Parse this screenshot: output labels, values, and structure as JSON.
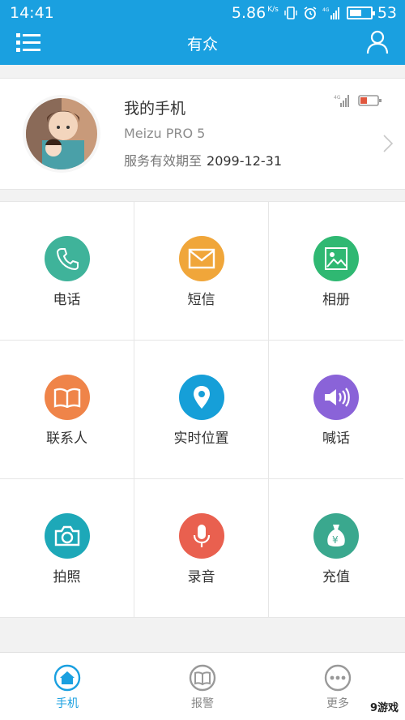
{
  "status_bar": {
    "time": "14:41",
    "net_speed": "5.86",
    "net_unit": "K/s",
    "signal": "4G",
    "battery": "53"
  },
  "header": {
    "title": "有众",
    "menu_icon": "menu-list-icon",
    "user_icon": "user-icon"
  },
  "profile": {
    "name": "我的手机",
    "model": "Meizu PRO 5",
    "expiry_label": "服务有效期至",
    "expiry_date": "2099-12-31",
    "signal_label": "4G"
  },
  "grid": [
    {
      "label": "电话",
      "icon": "phone-icon",
      "color": "#3fb39a"
    },
    {
      "label": "短信",
      "icon": "mail-icon",
      "color": "#f0a63a"
    },
    {
      "label": "相册",
      "icon": "image-icon",
      "color": "#2fb872"
    },
    {
      "label": "联系人",
      "icon": "book-icon",
      "color": "#ef8449"
    },
    {
      "label": "实时位置",
      "icon": "location-pin-icon",
      "color": "#169fd8"
    },
    {
      "label": "喊话",
      "icon": "speaker-icon",
      "color": "#8a63d8"
    },
    {
      "label": "拍照",
      "icon": "camera-icon",
      "color": "#1da8b8"
    },
    {
      "label": "录音",
      "icon": "microphone-icon",
      "color": "#e9604f"
    },
    {
      "label": "充值",
      "icon": "money-bag-icon",
      "color": "#3aa88e"
    }
  ],
  "tabs": [
    {
      "label": "手机",
      "icon": "home-icon"
    },
    {
      "label": "报警",
      "icon": "alarm-book-icon"
    },
    {
      "label": "更多",
      "icon": "more-dots-icon"
    }
  ],
  "watermark": "9游戏",
  "colors": {
    "primary": "#1aa0e0",
    "background": "#f2f2f2"
  }
}
